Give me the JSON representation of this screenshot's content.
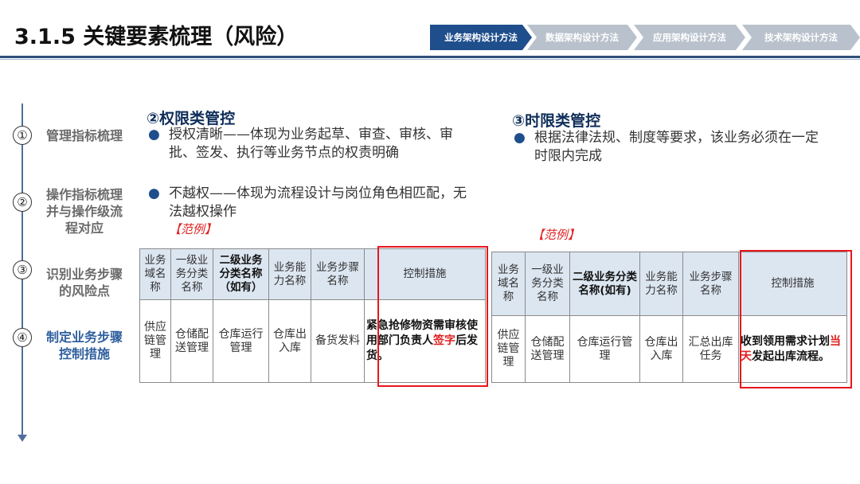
{
  "title": "3.1.5 关键要素梳理（风险）",
  "nav": {
    "steps": [
      {
        "label": "业务架构设计方法",
        "active": true
      },
      {
        "label": "数据架构设计方法",
        "active": false
      },
      {
        "label": "应用架构设计方法",
        "active": false
      },
      {
        "label": "技术架构设计方法",
        "active": false
      }
    ]
  },
  "steps": [
    {
      "num": "①",
      "label": "管理指标梳理"
    },
    {
      "num": "②",
      "label": "操作指标梳理并与操作级流程对应"
    },
    {
      "num": "③",
      "label": "识别业务步骤的风险点"
    },
    {
      "num": "④",
      "label": "制定业务步骤控制措施"
    }
  ],
  "authority": {
    "title": "②权限类管控",
    "bullet_mark": "●",
    "bullets": [
      "授权清晰——体现为业务起草、审查、审核、审批、签发、执行等业务节点的权责明确",
      "不越权——体现为流程设计与岗位角色相匹配，无法越权操作"
    ],
    "example_label": "【范例】"
  },
  "timelimit": {
    "title": "③时限类管控",
    "bullet_mark": "●",
    "bullets": [
      "根据法律法规、制度等要求，该业务必须在一定时限内完成"
    ],
    "example_label": "【范例】"
  },
  "table1": {
    "headers": [
      "业务域名称",
      "一级业务分类名称",
      "二级业务分类名称（如有）",
      "业务能力名称",
      "业务步骤名称",
      "控制措施"
    ],
    "row": {
      "c0": "供应链管理",
      "c1": "仓储配送管理",
      "c2": "仓库运行管理",
      "c3": "仓库出入库",
      "c4": "备货发料",
      "ctrl_a": "紧急抢修物资需审核使用部门负责人",
      "ctrl_red": "签字",
      "ctrl_b": "后发货。"
    }
  },
  "table2": {
    "headers": [
      "业务域名称",
      "一级业务分类名称",
      "二级业务分类名称(如有)",
      "业务能力名称",
      "业务步骤名称",
      "控制措施"
    ],
    "row": {
      "c0": "供应链管理",
      "c1": "仓储配送管理",
      "c2": "仓库运行管理",
      "c3": "仓库出入库",
      "c4": "汇总出库任务",
      "ctrl_a": "收到领用需求计划",
      "ctrl_red": "当天",
      "ctrl_b": "发起出库流程。"
    }
  },
  "colors": {
    "accent": "#1f4e8c",
    "nav_inactive": "#b9c2cc",
    "highlight_red": "#e8161c",
    "header_fill": "#dce6f1"
  }
}
